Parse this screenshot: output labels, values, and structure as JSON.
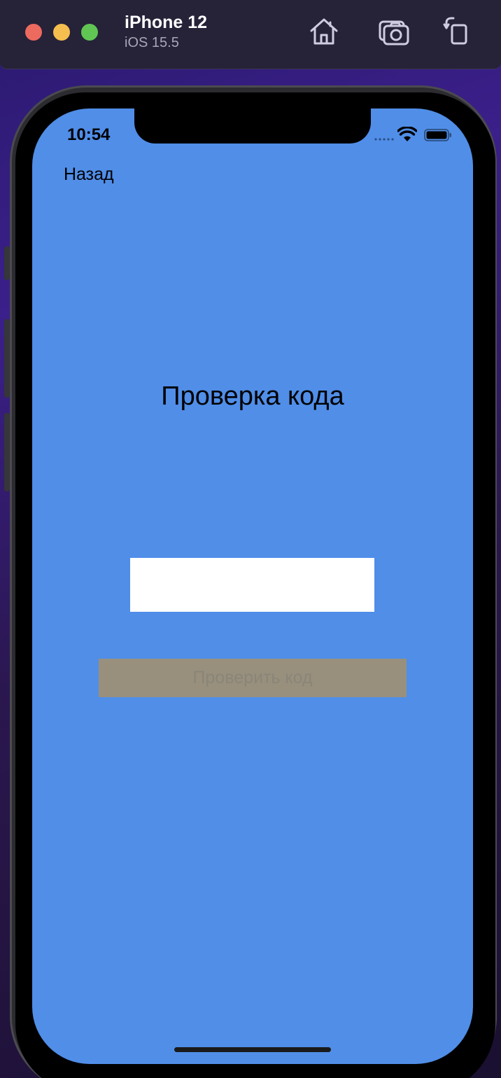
{
  "simulator": {
    "device_name": "iPhone 12",
    "os_version": "iOS 15.5",
    "toolbar_icons": [
      "home-icon",
      "screenshot-icon",
      "rotate-icon"
    ]
  },
  "status_bar": {
    "time": "10:54"
  },
  "nav": {
    "back_label": "Назад"
  },
  "main": {
    "title": "Проверка кода",
    "code_input_value": "",
    "verify_button_label": "Проверить код"
  },
  "colors": {
    "screen_background": "#508ee8",
    "button_background": "#98907d",
    "button_text": "#8a8579",
    "input_background": "#ffffff"
  }
}
